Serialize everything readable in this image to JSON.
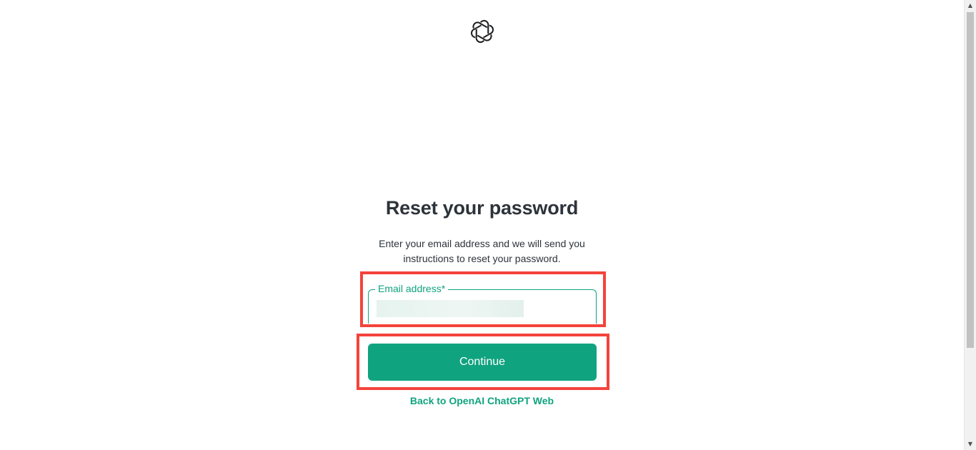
{
  "logo": {
    "icon": "openai-logo-icon"
  },
  "heading": "Reset your password",
  "description": "Enter your email address and we will send you instructions to reset your password.",
  "email_field": {
    "label": "Email address*",
    "value": ""
  },
  "continue_button": "Continue",
  "back_link": "Back to OpenAI ChatGPT Web",
  "colors": {
    "accent": "#10a37f",
    "highlight": "#f4433b",
    "text": "#2d333a"
  },
  "scrollbar": {
    "up_arrow": "▲",
    "down_arrow": "▼"
  }
}
